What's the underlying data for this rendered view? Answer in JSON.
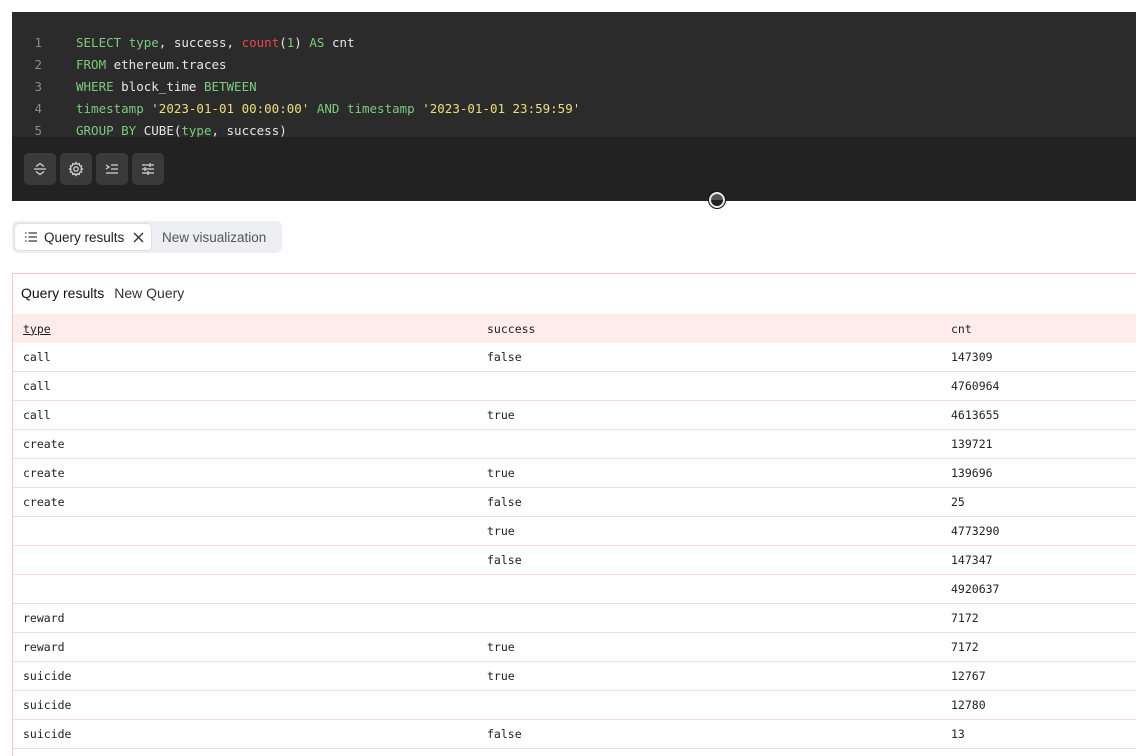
{
  "editor": {
    "lines": [
      {
        "n": "1",
        "tokens": [
          {
            "t": "SELECT ",
            "c": "kw"
          },
          {
            "t": "type",
            "c": "kw"
          },
          {
            "t": ", success, ",
            "c": "id"
          },
          {
            "t": "count",
            "c": "fn"
          },
          {
            "t": "(",
            "c": "id"
          },
          {
            "t": "1",
            "c": "num"
          },
          {
            "t": ") ",
            "c": "id"
          },
          {
            "t": "AS",
            "c": "kw"
          },
          {
            "t": " cnt",
            "c": "id"
          }
        ]
      },
      {
        "n": "2",
        "tokens": [
          {
            "t": "FROM",
            "c": "kw"
          },
          {
            "t": " ethereum.traces",
            "c": "id"
          }
        ]
      },
      {
        "n": "3",
        "tokens": [
          {
            "t": "WHERE",
            "c": "kw"
          },
          {
            "t": " block_time ",
            "c": "id"
          },
          {
            "t": "BETWEEN",
            "c": "kw"
          }
        ]
      },
      {
        "n": "4",
        "tokens": [
          {
            "t": "timestamp",
            "c": "kw"
          },
          {
            "t": " ",
            "c": "id"
          },
          {
            "t": "'2023-01-01 00:00:00'",
            "c": "str"
          },
          {
            "t": " ",
            "c": "id"
          },
          {
            "t": "AND",
            "c": "kw"
          },
          {
            "t": " ",
            "c": "id"
          },
          {
            "t": "timestamp",
            "c": "kw"
          },
          {
            "t": " ",
            "c": "id"
          },
          {
            "t": "'2023-01-01 23:59:59'",
            "c": "str"
          }
        ]
      },
      {
        "n": "5",
        "tokens": [
          {
            "t": "GROUP BY",
            "c": "kw"
          },
          {
            "t": " CUBE(",
            "c": "id"
          },
          {
            "t": "type",
            "c": "kw"
          },
          {
            "t": ", success)",
            "c": "id"
          }
        ]
      }
    ],
    "toolbar": [
      {
        "name": "format-toggle-button",
        "icon": "expand-collapse-icon"
      },
      {
        "name": "settings-button",
        "icon": "gear-icon"
      },
      {
        "name": "indent-button",
        "icon": "indent-icon"
      },
      {
        "name": "parameters-button",
        "icon": "sliders-icon"
      }
    ]
  },
  "tabs": {
    "active": {
      "label": "Query results",
      "icon": "list-icon",
      "close_icon": "close-icon"
    },
    "inactive": {
      "label": "New visualization"
    }
  },
  "results": {
    "title": "Query results",
    "subtitle": "New Query",
    "columns": [
      "type",
      "success",
      "cnt"
    ],
    "rows": [
      [
        "call",
        "false",
        "147309"
      ],
      [
        "call",
        "",
        "4760964"
      ],
      [
        "call",
        "true",
        "4613655"
      ],
      [
        "create",
        "",
        "139721"
      ],
      [
        "create",
        "true",
        "139696"
      ],
      [
        "create",
        "false",
        "25"
      ],
      [
        "",
        "true",
        "4773290"
      ],
      [
        "",
        "false",
        "147347"
      ],
      [
        "",
        "",
        "4920637"
      ],
      [
        "reward",
        "",
        "7172"
      ],
      [
        "reward",
        "true",
        "7172"
      ],
      [
        "suicide",
        "true",
        "12767"
      ],
      [
        "suicide",
        "",
        "12780"
      ],
      [
        "suicide",
        "false",
        "13"
      ]
    ]
  },
  "colors": {
    "editor_bg": "#2b2b2b",
    "keyword": "#7ec97e",
    "function": "#e8454b",
    "string": "#e8e07a",
    "table_header_bg": "#fdeceb",
    "panel_border": "#f2c7c2"
  }
}
